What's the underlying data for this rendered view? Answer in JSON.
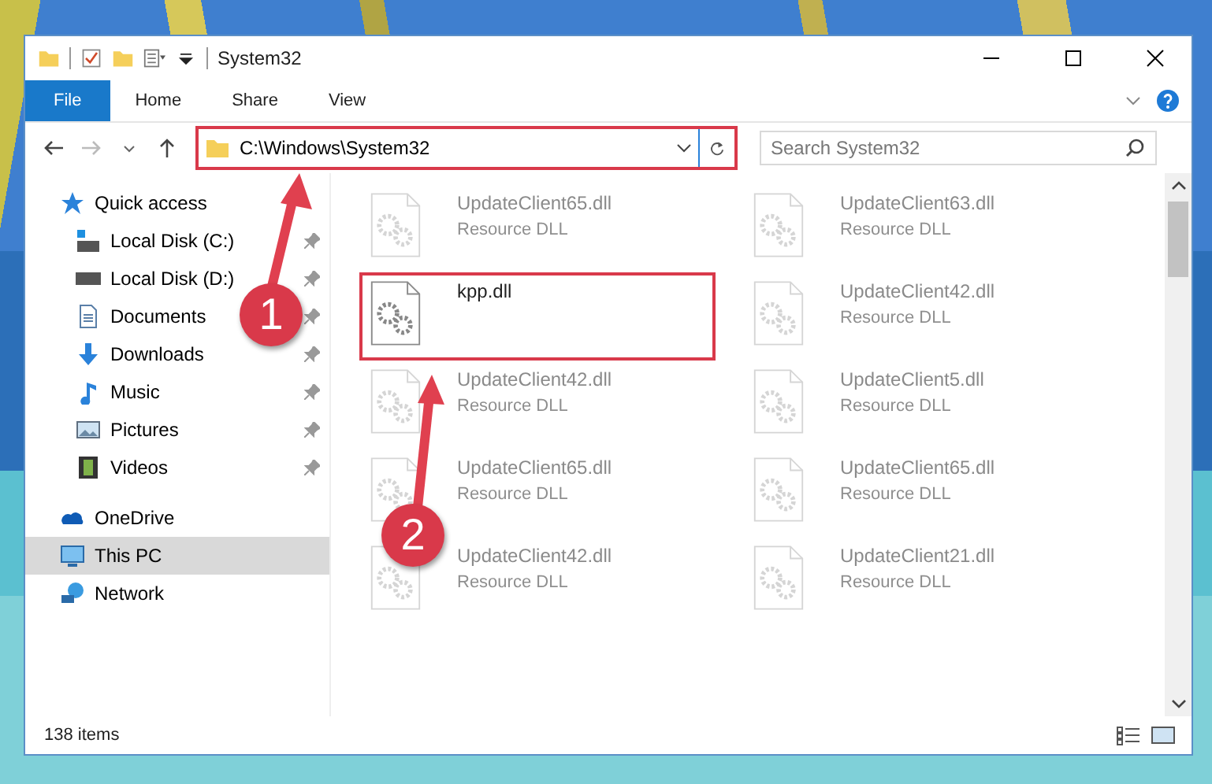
{
  "window": {
    "title": "System32"
  },
  "ribbon": {
    "tabs": [
      {
        "label": "File",
        "selected": true
      },
      {
        "label": "Home",
        "selected": false
      },
      {
        "label": "Share",
        "selected": false
      },
      {
        "label": "View",
        "selected": false
      }
    ]
  },
  "address": {
    "path": "C:\\Windows\\System32",
    "highlighted": true
  },
  "search": {
    "placeholder": "Search System32"
  },
  "sidebar": {
    "items": [
      {
        "label": "Quick access",
        "selected": false,
        "children": [
          {
            "label": "Local Disk (C:)",
            "pinned": true
          },
          {
            "label": "Local Disk (D:)",
            "pinned": true
          },
          {
            "label": "Documents",
            "pinned": true
          },
          {
            "label": "Downloads",
            "pinned": true
          },
          {
            "label": "Music",
            "pinned": true
          },
          {
            "label": "Pictures",
            "pinned": true
          },
          {
            "label": "Videos",
            "pinned": true
          }
        ]
      },
      {
        "label": "OneDrive",
        "selected": false
      },
      {
        "label": "This PC",
        "selected": true
      },
      {
        "label": "Network",
        "selected": false
      }
    ]
  },
  "files": [
    {
      "name": "UpdateClient65.dll",
      "type": "Resource DLL",
      "faded": true,
      "highlighted": false
    },
    {
      "name": "UpdateClient63.dll",
      "type": "Resource DLL",
      "faded": true,
      "highlighted": false
    },
    {
      "name": "kpp.dll",
      "faded": false,
      "highlighted": true
    },
    {
      "name": "UpdateClient42.dll",
      "type": "Resource DLL",
      "faded": true,
      "highlighted": false
    },
    {
      "name": "UpdateClient42.dll",
      "type": "Resource DLL",
      "faded": true,
      "highlighted": false
    },
    {
      "name": "UpdateClient5.dll",
      "type": "Resource DLL",
      "faded": true,
      "highlighted": false
    },
    {
      "name": "UpdateClient65.dll",
      "type": "Resource DLL",
      "faded": true,
      "highlighted": false
    },
    {
      "name": "UpdateClient65.dll",
      "type": "Resource DLL",
      "faded": true,
      "highlighted": false
    },
    {
      "name": "UpdateClient42.dll",
      "type": "Resource DLL",
      "faded": true,
      "highlighted": false
    },
    {
      "name": "UpdateClient21.dll",
      "type": "Resource DLL",
      "faded": true,
      "highlighted": false
    }
  ],
  "status_bar": {
    "count": "138 items"
  },
  "annotations": [
    {
      "label": "1"
    },
    {
      "label": "2"
    }
  ]
}
